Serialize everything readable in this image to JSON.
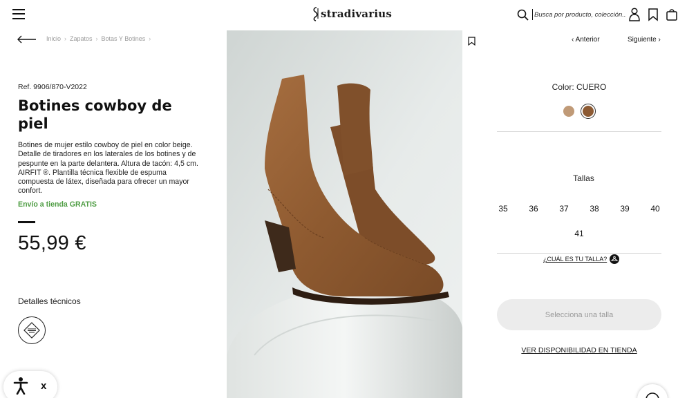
{
  "header": {
    "logo_text": "stradivarius",
    "search_placeholder": "Busca por producto, colección..."
  },
  "breadcrumb": [
    "Inicio",
    "Zapatos",
    "Botas Y Botines"
  ],
  "product": {
    "ref": "Ref. 9906/870-V2022",
    "title": "Botines cowboy de piel",
    "description": "Botines de mujer estilo cowboy de piel en color beige. Detalle de tiradores en los laterales de los botines y de pespunte en la parte delantera. Altura de tacón: 4,5 cm. AIRFIT ®. Plantilla técnica flexible de espuma compuesta de látex, diseñada para ofrecer un mayor confort.",
    "shipping": "Envío a tienda GRATIS",
    "price": "55,99 €",
    "tech_title": "Detalles técnicos"
  },
  "nav": {
    "prev": "Anterior",
    "next": "Siguiente"
  },
  "color": {
    "label": "Color: CUERO",
    "swatches": [
      {
        "name": "beige",
        "hex": "#c09a77"
      },
      {
        "name": "cuero",
        "hex": "#8c5a33",
        "selected": true
      }
    ]
  },
  "sizes": {
    "title": "Tallas",
    "values": [
      "35",
      "36",
      "37",
      "38",
      "39",
      "40",
      "41"
    ],
    "guide": "¿CUÁL ES TU TALLA?"
  },
  "actions": {
    "select_size": "Selecciona una talla",
    "store_availability": "VER DISPONIBILIDAD EN TIENDA"
  },
  "a11y": {
    "close": "x"
  },
  "colors": {
    "accent_green": "#4f9d44",
    "button_bg": "#ececec"
  }
}
